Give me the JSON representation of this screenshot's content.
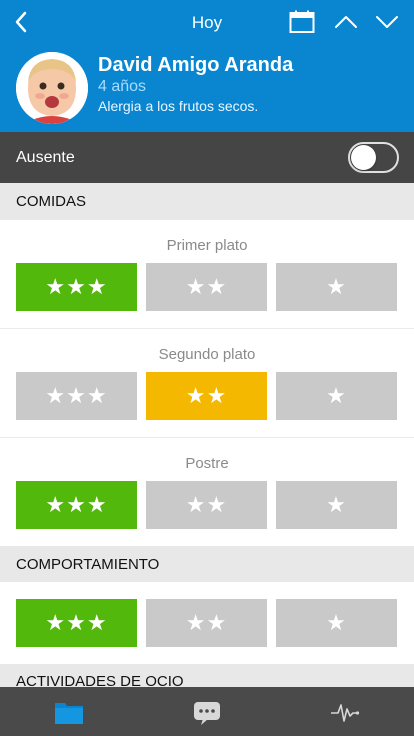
{
  "header": {
    "title": "Hoy",
    "student_name": "David Amigo Aranda",
    "age": "4 años",
    "allergy": "Alergia a los frutos secos.",
    "icons": [
      "chevron-left-icon",
      "calendar-icon",
      "chevron-up-icon",
      "chevron-down-icon"
    ]
  },
  "absent": {
    "label": "Ausente",
    "checked": false
  },
  "sections": {
    "comidas": "COMIDAS",
    "comportamiento": "COMPORTAMIENTO",
    "ocio": "ACTIVIDADES DE OCIO"
  },
  "meals": {
    "primer_plato": "Primer plato",
    "segundo_plato": "Segundo plato",
    "postre": "Postre"
  },
  "ratings": {
    "three": "★★★",
    "two": "★★",
    "one": "★"
  },
  "selected": {
    "primer_plato": "three",
    "segundo_plato": "two",
    "postre": "three",
    "comportamiento": "three"
  },
  "colors": {
    "header_blue": "#0a86d1",
    "selected_green": "#52b80b",
    "selected_orange": "#f5b800",
    "unselected_gray": "#c9c9c9",
    "tab_active": "#0a86d1"
  },
  "tabbar": {
    "items": [
      "folder-icon",
      "chat-icon",
      "activity-icon"
    ],
    "active": "folder-icon"
  }
}
